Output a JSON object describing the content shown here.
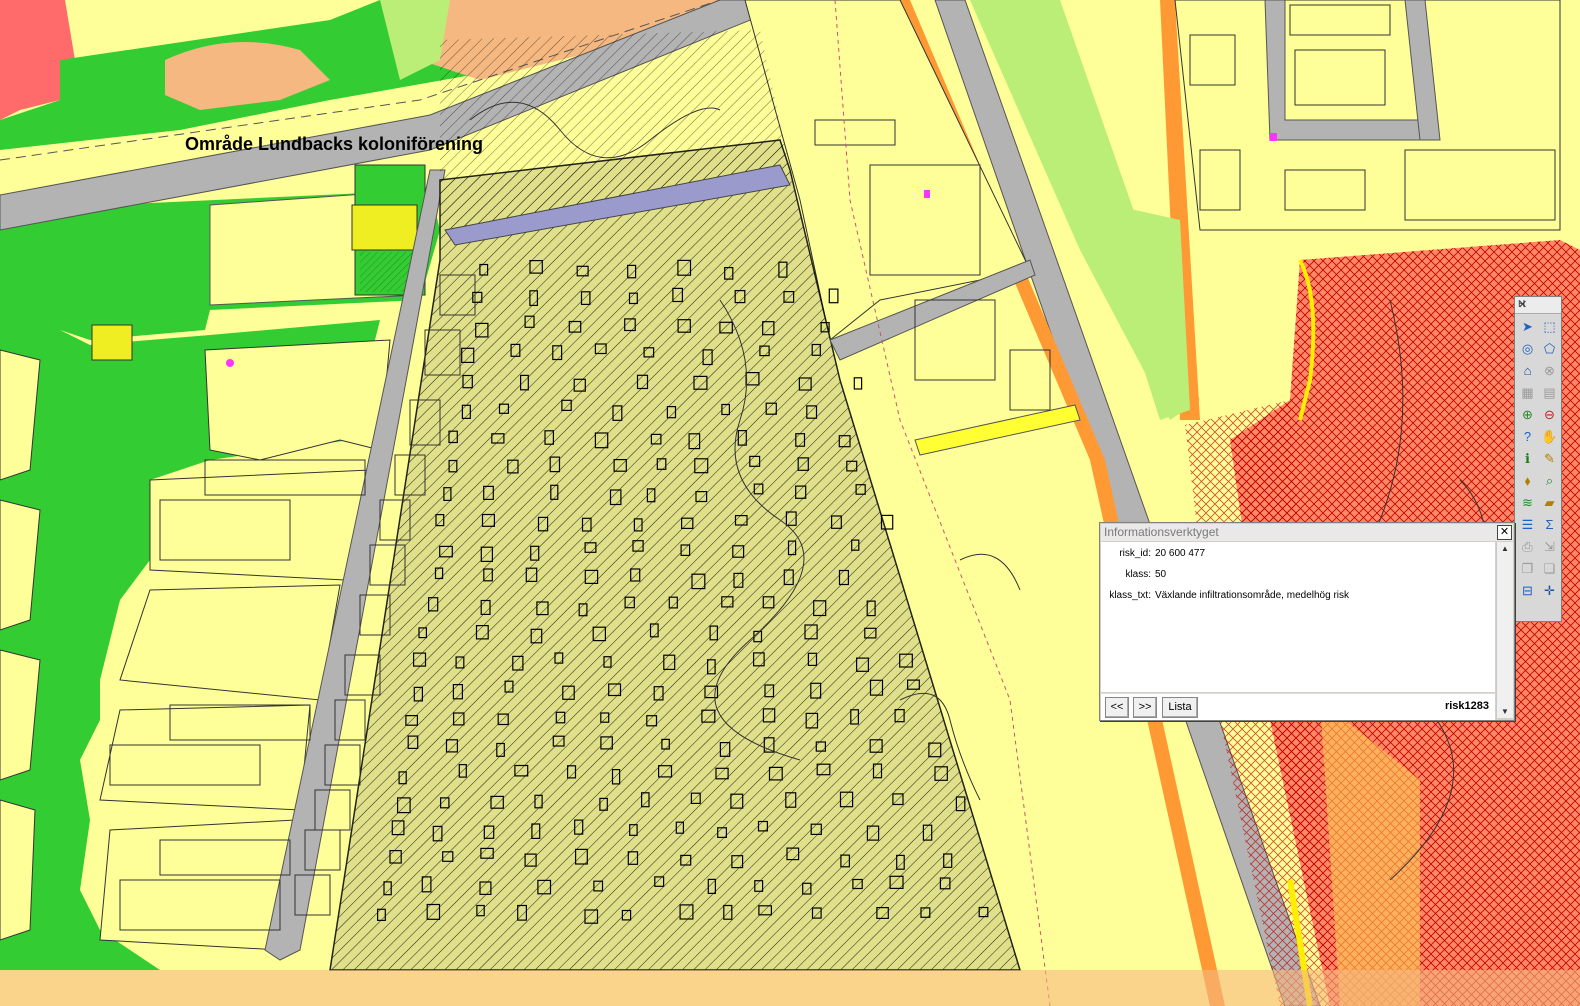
{
  "map": {
    "area_label": "Område Lundbacks koloniförening"
  },
  "info_window": {
    "title": "Informationsverktyget",
    "close_glyph": "✕",
    "fields": [
      {
        "key": "risk_id:",
        "value": "20 600 477"
      },
      {
        "key": "klass:",
        "value": "50"
      },
      {
        "key": "klass_txt:",
        "value": "Växlande infiltrationsområde, medelhög risk"
      }
    ],
    "prev_label": "<<",
    "next_label": ">>",
    "list_label": "Lista",
    "record_id": "risk1283",
    "scroll_up": "▲",
    "scroll_down": "▼"
  },
  "toolbar": {
    "title": "H",
    "close_glyph": "✕",
    "tools": [
      {
        "name": "select-arrow-icon",
        "glyph": "➤",
        "color": "#2060c0"
      },
      {
        "name": "select-box-icon",
        "glyph": "⬚",
        "color": "#2060c0"
      },
      {
        "name": "select-circle-icon",
        "glyph": "◎",
        "color": "#2060c0"
      },
      {
        "name": "select-polygon-icon",
        "glyph": "⬠",
        "color": "#2060c0"
      },
      {
        "name": "home-icon",
        "glyph": "⌂",
        "color": "#1c4fa0"
      },
      {
        "name": "disabled-tool-icon",
        "glyph": "⊗",
        "color": "#9a9a9a"
      },
      {
        "name": "buffer-icon",
        "glyph": "▦",
        "color": "#9a9a9a"
      },
      {
        "name": "layer-filter-icon",
        "glyph": "▤",
        "color": "#9a9a9a"
      },
      {
        "name": "zoom-in-icon",
        "glyph": "⊕",
        "color": "#2a8a2a"
      },
      {
        "name": "zoom-out-icon",
        "glyph": "⊖",
        "color": "#c02020"
      },
      {
        "name": "zoom-query-icon",
        "glyph": "?",
        "color": "#2060c0"
      },
      {
        "name": "pan-hand-icon",
        "glyph": "✋",
        "color": "#555555"
      },
      {
        "name": "info-icon",
        "glyph": "ℹ",
        "color": "#1c7a1c"
      },
      {
        "name": "edit-pen-icon",
        "glyph": "✎",
        "color": "#b08000"
      },
      {
        "name": "tag-icon",
        "glyph": "⬧",
        "color": "#b08000"
      },
      {
        "name": "search-map-icon",
        "glyph": "⌕",
        "color": "#2a8a2a"
      },
      {
        "name": "layers-icon",
        "glyph": "≋",
        "color": "#2a8a2a"
      },
      {
        "name": "ruler-icon",
        "glyph": "▰",
        "color": "#b08000"
      },
      {
        "name": "legend-icon",
        "glyph": "☰",
        "color": "#2060c0"
      },
      {
        "name": "sum-icon",
        "glyph": "Σ",
        "color": "#2060c0"
      },
      {
        "name": "print-icon",
        "glyph": "⎙",
        "color": "#9a9a9a"
      },
      {
        "name": "export-icon",
        "glyph": "⇲",
        "color": "#9a9a9a"
      },
      {
        "name": "copy-icon",
        "glyph": "❐",
        "color": "#9a9a9a"
      },
      {
        "name": "paste-icon",
        "glyph": "❏",
        "color": "#9a9a9a"
      },
      {
        "name": "scale-icon",
        "glyph": "⊟",
        "color": "#2060c0"
      },
      {
        "name": "crosshair-icon",
        "glyph": "✛",
        "color": "#1c4fa0"
      }
    ]
  }
}
